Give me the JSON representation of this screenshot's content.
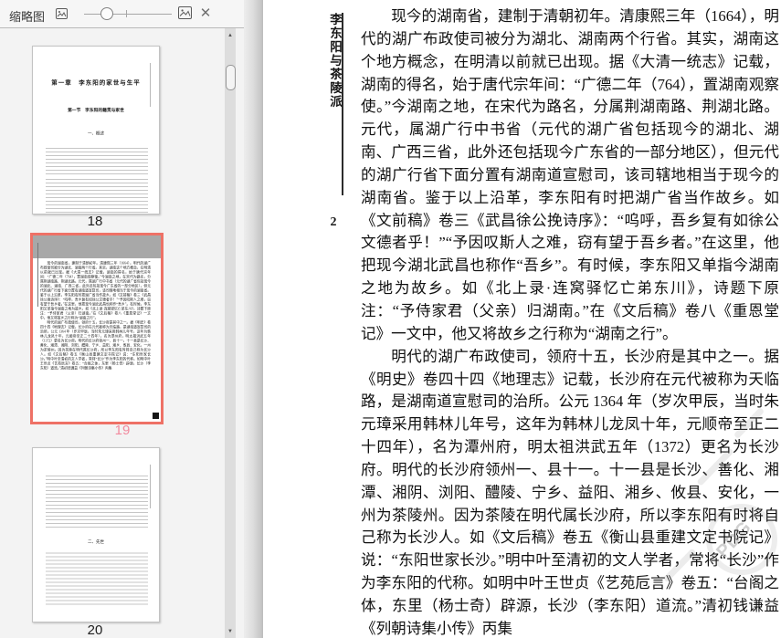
{
  "icons": {
    "close": "✕",
    "scroll_up": "▲",
    "scroll_down": "▼"
  },
  "sidebar": {
    "title": "缩略图",
    "thumbnails": [
      {
        "page_label": "18",
        "selected": false,
        "chapter_title": "第一章　李东阳的家世与生平",
        "section_title": "第一节　李东阳的籍贯与家世",
        "subsection_title": "一、概述"
      },
      {
        "page_label": "19",
        "selected": true
      },
      {
        "page_label": "20",
        "selected": false,
        "subsection_title": "二、先世"
      }
    ]
  },
  "page": {
    "book_spine_title": "李东阳与茶陵派",
    "page_number": "2",
    "paragraphs": [
      "现今的湖南省，建制于清朝初年。清康熙三年（1664），明代的湖广布政使司被分为湖北、湖南两个行省。其实，湖南这个地方概念，在明清以前就已出现。据《大清一统志》记载，湖南的得名，始于唐代宗年间：“广德二年（764），置湖南观察使。”今湖南之地，在宋代为路名，分属荆湖南路、荆湖北路。元代，属湖广行中书省（元代的湖广省包括现今的湖北、湖南、广西三省，此外还包括现今广东省的一部分地区），但元代的湖广行省下面分置有湖南道宣慰司，该司辖地相当于现今的湖南省。鉴于以上沿革，李东阳有时把湖广省当作故乡。如《文前稿》卷三《武昌徐公挽诗序》：“呜呼，吾乡复有如徐公文德者乎！”“予因叹斯人之难，窃有望于吾乡者。”在这里，他把现今湖北武昌也称作“吾乡”。有时候，李东阳又单指今湖南之地为故乡。如《北上录·连窝驿忆亡弟东川》，诗题下原注：“予侍家君（父亲）归湖南。”在《文后稿》卷八《重恩堂记》一文中，他又将故乡之行称为“湖南之行”。",
      "明代的湖广布政使司，领府十五，长沙府是其中之一。据《明史》卷四十四《地理志》记载，长沙府在元代被称为天临路，是湖南道宣慰司的治所。公元 1364 年（岁次甲辰，当时朱元璋采用韩林儿年号，这年为韩林儿龙凤十年，元顺帝至正二十四年），名为潭州府，明太祖洪武五年（1372）更名为长沙府。明代的长沙府领州一、县十一。十一县是长沙、善化、湘潭、湘阴、浏阳、醴陵、宁乡、益阳、湘乡、攸县、安化，一州为茶陵州。因为茶陵在明代属长沙府，所以李东阳有时将自己称为长沙人。如《文后稿》卷五《衡山县重建文定书院记》说：“东阳世家长沙。”明中叶至清初的文人学者，常将“长沙”作为李东阳的代称。如明中叶王世贞《艺苑卮言》卷五：“台阁之体，东里（杨士奇）辟源，长沙（李东阳）道流。”清初钱谦益《列朝诗集小传》丙集",
      ""
    ],
    "watermark": "PDG"
  },
  "colors": {
    "selection_border": "#ee7166",
    "selected_label": "#f28a9e",
    "sidebar_bg": "#f3f3f3",
    "scrollbar_track": "#dddddd"
  }
}
